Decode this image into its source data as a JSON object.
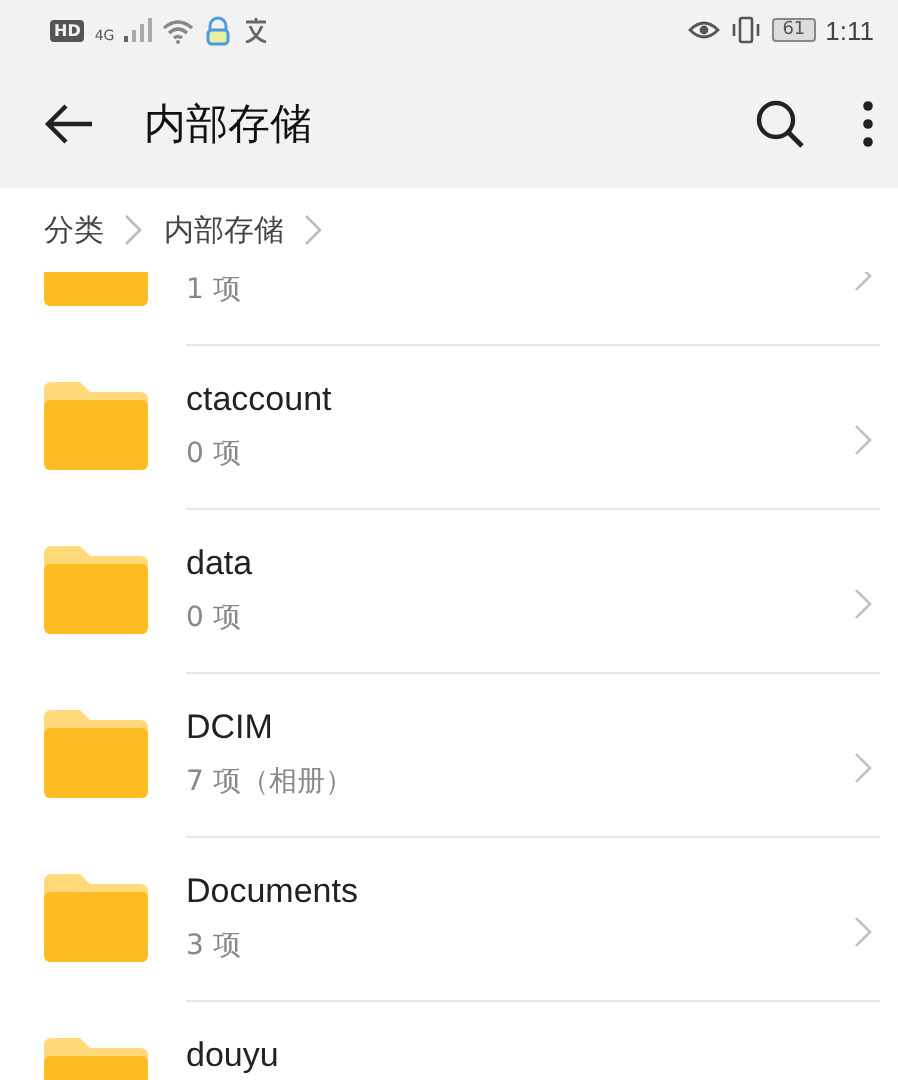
{
  "status_bar": {
    "hd_badge": "HD",
    "network": "4G",
    "battery": "61",
    "time": "1:11"
  },
  "header": {
    "title": "内部存储"
  },
  "breadcrumb": [
    "分类",
    "内部存储"
  ],
  "folders": [
    {
      "count": "1 项"
    },
    {
      "name": "ctaccount",
      "count": "0 项"
    },
    {
      "name": "data",
      "count": "0 项"
    },
    {
      "name": "DCIM",
      "count": "7 项（相册）"
    },
    {
      "name": "Documents",
      "count": "3 项"
    },
    {
      "name": "douyu"
    }
  ]
}
